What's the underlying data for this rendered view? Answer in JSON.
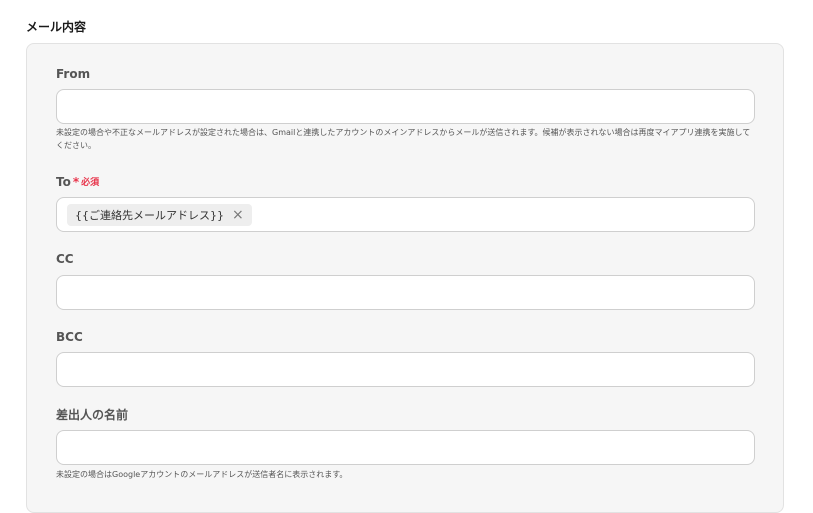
{
  "section": {
    "title": "メール内容"
  },
  "fields": {
    "from": {
      "label": "From",
      "value": "",
      "help": "未設定の場合や不正なメールアドレスが設定された場合は、Gmailと連携したアカウントのメインアドレスからメールが送信されます。候補が表示されない場合は再度マイアプリ連携を実施してください。"
    },
    "to": {
      "label": "To",
      "required_mark": "*",
      "required_text": "必須",
      "tags": [
        {
          "label": "{{ご連絡先メールアドレス}}",
          "remove": "×"
        }
      ]
    },
    "cc": {
      "label": "CC",
      "value": ""
    },
    "bcc": {
      "label": "BCC",
      "value": ""
    },
    "sender_name": {
      "label": "差出人の名前",
      "value": "",
      "help": "未設定の場合はGoogleアカウントのメールアドレスが送信者名に表示されます。"
    }
  }
}
